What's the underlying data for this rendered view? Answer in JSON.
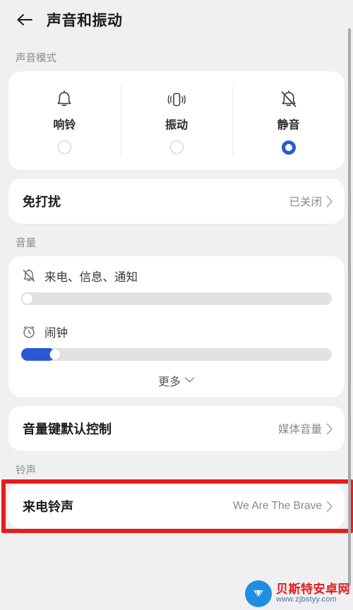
{
  "header": {
    "title": "声音和振动",
    "back_icon": "arrow-left-icon"
  },
  "sound_mode_section": {
    "label": "声音模式",
    "modes": [
      {
        "label": "响铃",
        "icon": "bell-icon",
        "selected": false
      },
      {
        "label": "振动",
        "icon": "vibrate-icon",
        "selected": false
      },
      {
        "label": "静音",
        "icon": "bell-off-icon",
        "selected": true
      }
    ]
  },
  "dnd_row": {
    "title": "免打扰",
    "value": "已关闭",
    "chevron": "chevron-right-icon"
  },
  "volume_section": {
    "label": "音量",
    "sliders": [
      {
        "name": "来电、信息、通知",
        "icon": "bell-off-icon",
        "value_percent": 0
      },
      {
        "name": "闹钟",
        "icon": "alarm-clock-icon",
        "value_percent": 11
      }
    ],
    "more_label": "更多",
    "more_icon": "chevron-down-icon"
  },
  "volume_key_row": {
    "title": "音量键默认控制",
    "value": "媒体音量",
    "chevron": "chevron-right-icon"
  },
  "ringtone_section": {
    "label": "铃声",
    "row": {
      "title": "来电铃声",
      "value": "We Are The Brave",
      "chevron": "chevron-right-icon"
    }
  },
  "watermark": {
    "name": "贝斯特安卓网",
    "url": "www.zjbstyy.com"
  },
  "colors": {
    "accent": "#2b59d4",
    "highlight": "#e81c1c",
    "background": "#f0f0f2",
    "card": "#ffffff"
  }
}
